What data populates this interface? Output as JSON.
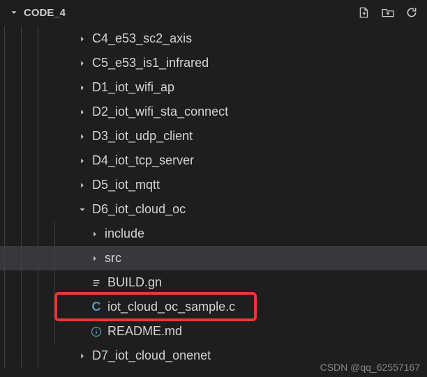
{
  "header": {
    "title": "CODE_4"
  },
  "tree": {
    "items": [
      {
        "type": "folder",
        "expanded": false,
        "depth": 3,
        "name": "C4_e53_sc2_axis"
      },
      {
        "type": "folder",
        "expanded": false,
        "depth": 3,
        "name": "C5_e53_is1_infrared"
      },
      {
        "type": "folder",
        "expanded": false,
        "depth": 3,
        "name": "D1_iot_wifi_ap"
      },
      {
        "type": "folder",
        "expanded": false,
        "depth": 3,
        "name": "D2_iot_wifi_sta_connect"
      },
      {
        "type": "folder",
        "expanded": false,
        "depth": 3,
        "name": "D3_iot_udp_client"
      },
      {
        "type": "folder",
        "expanded": false,
        "depth": 3,
        "name": "D4_iot_tcp_server"
      },
      {
        "type": "folder",
        "expanded": false,
        "depth": 3,
        "name": "D5_iot_mqtt"
      },
      {
        "type": "folder",
        "expanded": true,
        "depth": 3,
        "name": "D6_iot_cloud_oc"
      },
      {
        "type": "folder",
        "expanded": false,
        "depth": 4,
        "name": "include"
      },
      {
        "type": "folder",
        "expanded": false,
        "depth": 4,
        "name": "src",
        "selected": true
      },
      {
        "type": "file",
        "icon": "lines",
        "depth": 4,
        "name": "BUILD.gn"
      },
      {
        "type": "file",
        "icon": "c",
        "depth": 4,
        "name": "iot_cloud_oc_sample.c",
        "highlighted": true
      },
      {
        "type": "file",
        "icon": "info",
        "depth": 4,
        "name": "README.md"
      },
      {
        "type": "folder",
        "expanded": false,
        "depth": 3,
        "name": "D7_iot_cloud_onenet"
      }
    ]
  },
  "watermark": "CSDN @qq_62557167"
}
